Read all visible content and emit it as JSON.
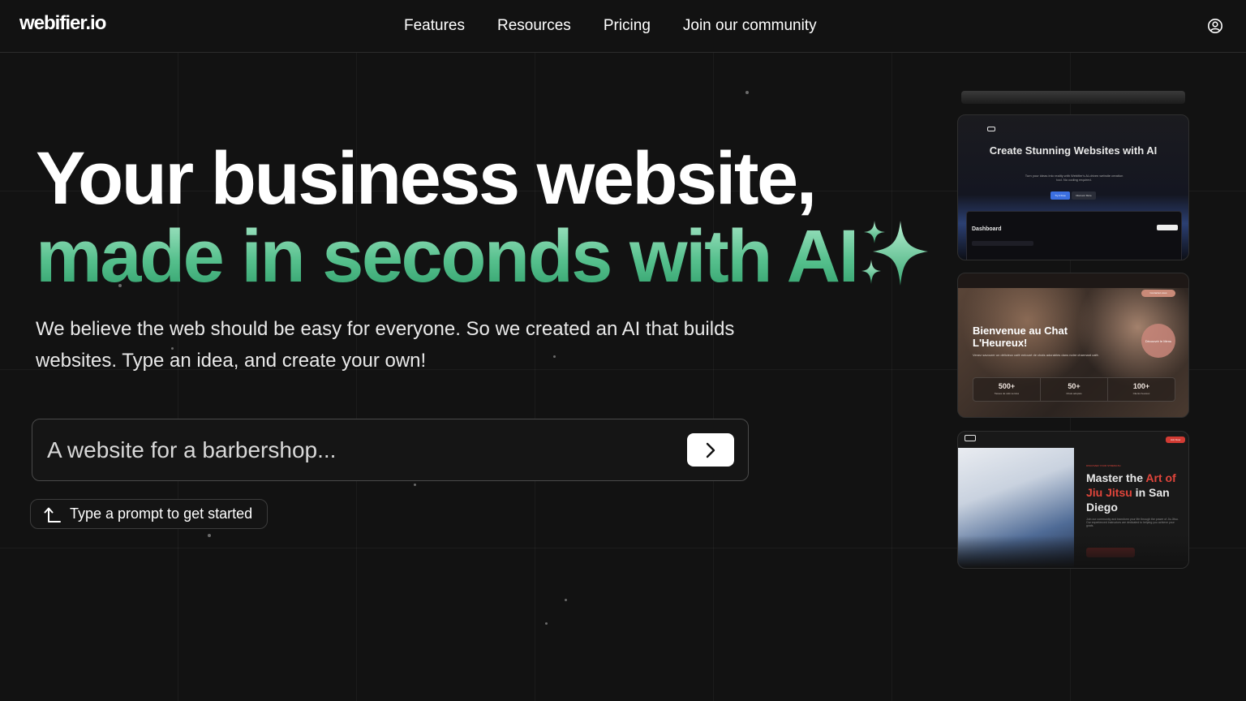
{
  "header": {
    "logo": "webifier.io",
    "nav": [
      "Features",
      "Resources",
      "Pricing",
      "Join our community"
    ]
  },
  "hero": {
    "title_line1": "Your business website,",
    "title_line2": "made in seconds with AI",
    "subtitle": "We believe the web should be easy for everyone. So we created an AI that builds websites. Type an idea, and create your own!",
    "prompt_placeholder": "A website for a barbershop...",
    "hint": "Type a prompt to get started"
  },
  "previews": {
    "card1": {
      "title": "Create Stunning Websites with AI",
      "subtitle": "Turn your ideas into reality with Webifier's AI-driven website creation tool. No coding required.",
      "primary_button": "Try it Free",
      "secondary_button": "Discover More",
      "dashboard_title": "Dashboard"
    },
    "card2": {
      "title": "Bienvenue au Chat L'Heureux!",
      "text": "Venez savourer un délicieux café entouré de chats adorables dans notre charmant café.",
      "badge": "Découvrir le Menu",
      "cta": "Contactez-nous",
      "stats": [
        {
          "value": "500+",
          "label": "Tasses de café servies"
        },
        {
          "value": "50+",
          "label": "Chats adoptés"
        },
        {
          "value": "100+",
          "label": "Clients heureux"
        }
      ]
    },
    "card3": {
      "kicker": "DISCOVER YOUR STRENGTH",
      "title_a": "Master the ",
      "title_b": "Art of Jiu Jitsu",
      "title_c": " in San Diego",
      "text": "Join our community and transform your life through the power of Jiu Jitsu. Our experienced instructors are dedicated to helping you achieve your goals.",
      "join": "Join Now"
    }
  },
  "colors": {
    "background": "#121212",
    "accent_green": "#56c08d",
    "accent_red": "#e0453b"
  }
}
